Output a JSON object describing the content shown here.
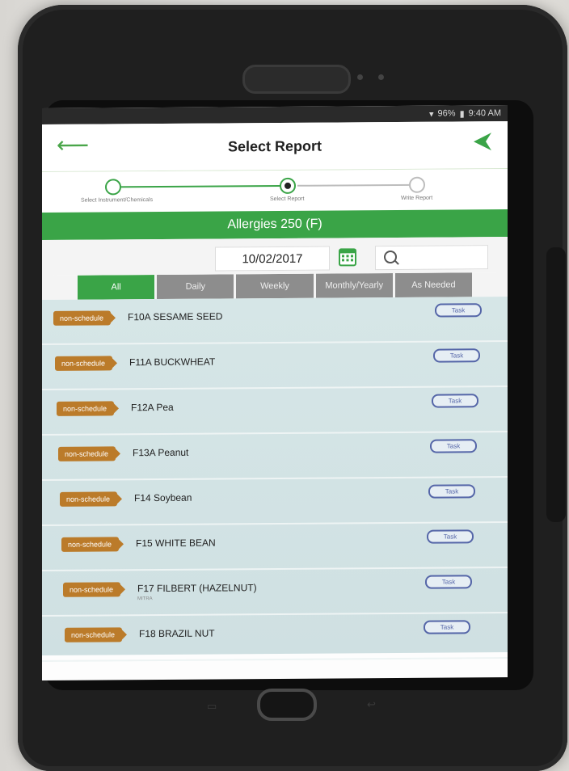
{
  "status_bar": {
    "battery": "96%",
    "time": "9:40 AM"
  },
  "header": {
    "title": "Select Report"
  },
  "steps": [
    {
      "label": "Select Instrument/Chemicals"
    },
    {
      "label": "Select Report"
    },
    {
      "label": "Write Report"
    }
  ],
  "banner": {
    "title": "Allergies 250 (F)"
  },
  "filters": {
    "date": "10/02/2017",
    "search_placeholder": ""
  },
  "tabs": [
    "All",
    "Daily",
    "Weekly",
    "Monthly/Yearly",
    "As Needed"
  ],
  "rows": [
    {
      "badge": "non-schedule",
      "title": "F10A SESAME SEED",
      "task": "Task",
      "sub": ""
    },
    {
      "badge": "non-schedule",
      "title": "F11A BUCKWHEAT",
      "task": "Task",
      "sub": ""
    },
    {
      "badge": "non-schedule",
      "title": "F12A Pea",
      "task": "Task",
      "sub": ""
    },
    {
      "badge": "non-schedule",
      "title": "F13A Peanut",
      "task": "Task",
      "sub": ""
    },
    {
      "badge": "non-schedule",
      "title": "F14 Soybean",
      "task": "Task",
      "sub": ""
    },
    {
      "badge": "non-schedule",
      "title": "F15 WHITE BEAN",
      "task": "Task",
      "sub": ""
    },
    {
      "badge": "non-schedule",
      "title": "F17 FILBERT (HAZELNUT)",
      "task": "Task",
      "sub": "MITRA"
    },
    {
      "badge": "non-schedule",
      "title": "F18 BRAZIL NUT",
      "task": "Task",
      "sub": ""
    }
  ],
  "colors": {
    "accent": "#3aa447",
    "badge": "#bb7b2a",
    "task_border": "#5566a8",
    "tab_inactive": "#8d8d8d"
  }
}
